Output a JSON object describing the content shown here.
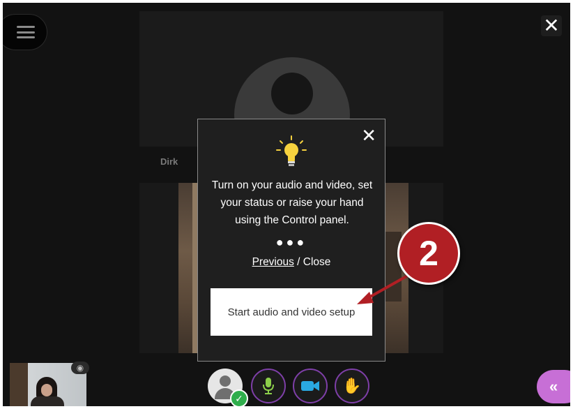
{
  "session": {
    "participant_name": "Dirk"
  },
  "top_bar": {
    "exit_icon": "✕"
  },
  "tooltip": {
    "icon": "lightbulb-icon",
    "close_icon": "✕",
    "message": "Turn on your audio and video, set your status or raise your hand using the Control panel.",
    "dots": "●●●",
    "previous_label": "Previous",
    "separator": " / ",
    "close_label": "Close",
    "setup_button_label": "Start audio and video setup"
  },
  "callout": {
    "number": "2",
    "color": "#b11f24"
  },
  "control_panel": {
    "status_ok_icon": "✓",
    "hand_icon": "✋",
    "collab_icon": "«",
    "accent_color": "#7e3fa8",
    "collab_color": "#c76fd6"
  },
  "self_view": {
    "eye_icon": "◉"
  }
}
